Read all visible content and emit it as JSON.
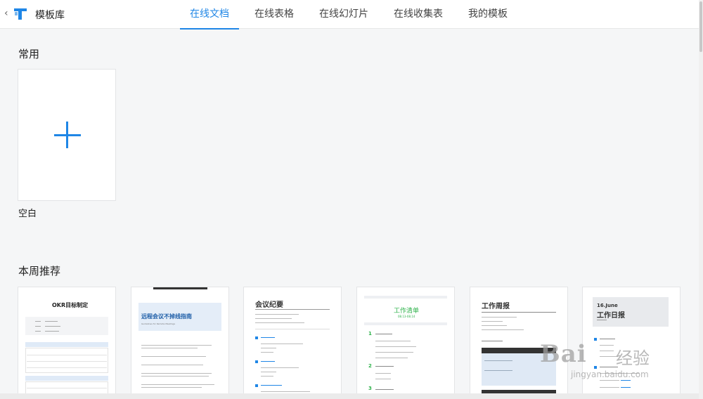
{
  "header": {
    "back_glyph": "‹",
    "logo_icon": "tencent-docs-logo-icon",
    "title": "模板库",
    "tabs": [
      {
        "label": "在线文档",
        "active": true
      },
      {
        "label": "在线表格",
        "active": false
      },
      {
        "label": "在线幻灯片",
        "active": false
      },
      {
        "label": "在线收集表",
        "active": false
      },
      {
        "label": "我的模板",
        "active": false
      }
    ]
  },
  "common": {
    "title": "常用",
    "blank_label": "空白",
    "plus_icon": "plus-icon"
  },
  "weekly": {
    "title": "本周推荐",
    "templates": [
      {
        "heading": "OKR目标制定"
      },
      {
        "heading": "远程会议不掉线指南",
        "subtitle": "Guidelines for Remote Meetings"
      },
      {
        "heading": "会议纪要"
      },
      {
        "heading": "工作清单",
        "date": "08.13-08.14"
      },
      {
        "heading": "工作周报"
      },
      {
        "date_label": "16.June",
        "heading": "工作日报"
      }
    ]
  },
  "watermark": {
    "brand": "Bai",
    "brand_cn": "经验",
    "url": "jingyan.baidu.com"
  },
  "colors": {
    "accent": "#1f86e6",
    "green": "#2db24a",
    "light_blue": "#e4edf8",
    "dark_bar": "#333333"
  }
}
